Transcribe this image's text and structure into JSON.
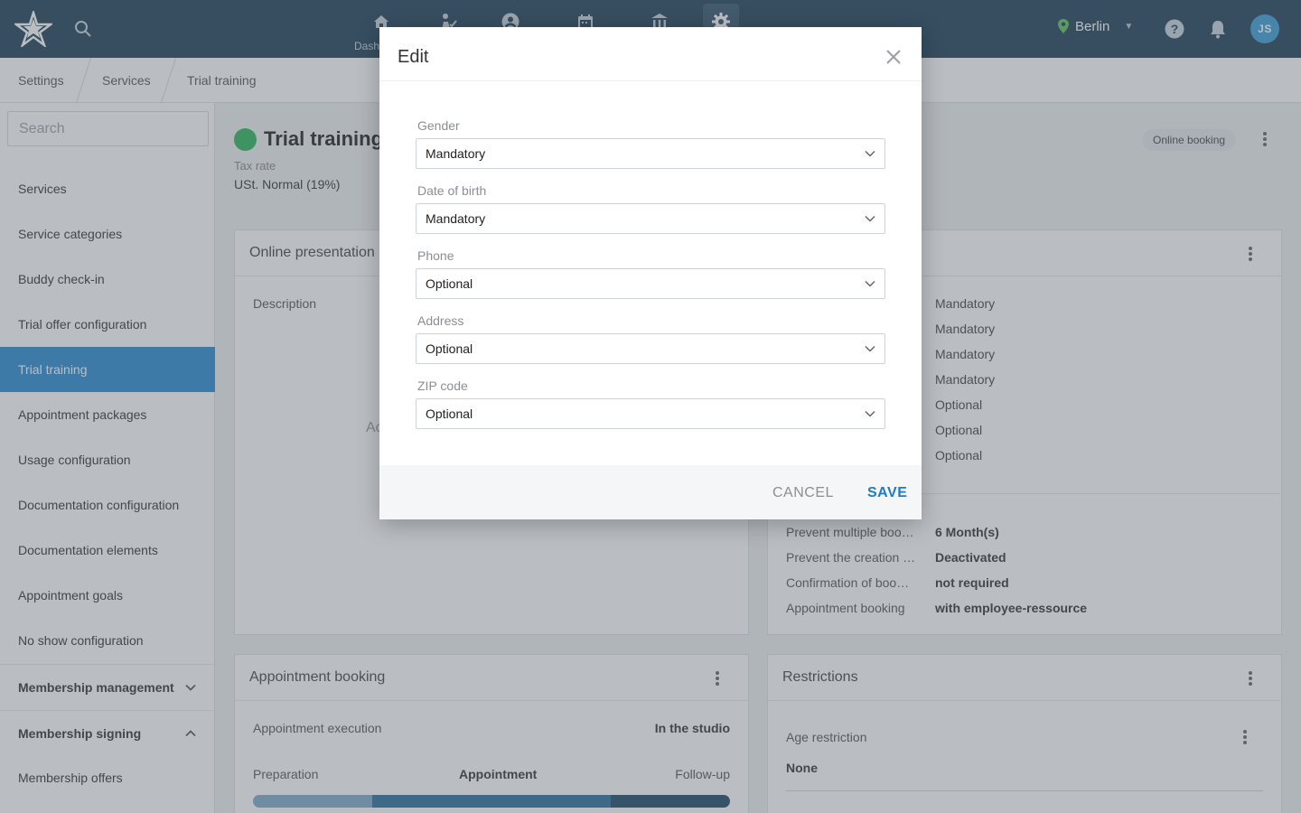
{
  "topbar": {
    "nav_partial_label": "Dash",
    "location": "Berlin",
    "user_initials": "JS"
  },
  "breadcrumb": [
    "Settings",
    "Services",
    "Trial training"
  ],
  "sidebar": {
    "search_placeholder": "Search",
    "items": [
      {
        "label": "Services"
      },
      {
        "label": "Service categories"
      },
      {
        "label": "Buddy check-in"
      },
      {
        "label": "Trial offer configuration"
      },
      {
        "label": "Trial training",
        "active": true
      },
      {
        "label": "Appointment packages"
      },
      {
        "label": "Usage configuration"
      },
      {
        "label": "Documentation configuration"
      },
      {
        "label": "Documentation elements"
      },
      {
        "label": "Appointment goals"
      },
      {
        "label": "No show configuration"
      }
    ],
    "groups": [
      {
        "label": "Membership management",
        "expanded": false
      },
      {
        "label": "Membership signing",
        "expanded": true
      }
    ],
    "sub_items": [
      {
        "label": "Membership offers"
      }
    ]
  },
  "service": {
    "title": "Trial training",
    "tax_label": "Tax rate",
    "tax_value": "USt. Normal (19%)",
    "online_badge": "Online booking",
    "status_color": "#2bb35b"
  },
  "online_presentation": {
    "title": "Online presentation",
    "description_label": "Description",
    "partial_text": "Ac"
  },
  "customer_data_values": [
    "Mandatory",
    "Mandatory",
    "Mandatory",
    "Mandatory",
    "Optional",
    "Optional",
    "Optional"
  ],
  "booking_settings": [
    {
      "label": "Prevent multiple boo…",
      "value": "6 Month(s)"
    },
    {
      "label": "Prevent the creation …",
      "value": "Deactivated"
    },
    {
      "label": "Confirmation of boo…",
      "value": "not required"
    },
    {
      "label": "Appointment booking",
      "value": "with employee-ressource"
    }
  ],
  "appointment_booking": {
    "title": "Appointment booking",
    "execution_label": "Appointment execution",
    "execution_value": "In the studio",
    "phases": [
      "Preparation",
      "Appointment",
      "Follow-up"
    ],
    "phase_fractions": [
      0.25,
      0.5,
      0.25
    ],
    "phase_colors": [
      "#7fa9c8",
      "#2a6f9e",
      "#1c4966"
    ]
  },
  "restrictions": {
    "title": "Restrictions",
    "age_label": "Age restriction",
    "age_value": "None"
  },
  "modal": {
    "title": "Edit",
    "fields": [
      {
        "label": "Gender",
        "value": "Mandatory"
      },
      {
        "label": "Date of birth",
        "value": "Mandatory"
      },
      {
        "label": "Phone",
        "value": "Optional"
      },
      {
        "label": "Address",
        "value": "Optional"
      },
      {
        "label": "ZIP code",
        "value": "Optional"
      }
    ],
    "cancel_label": "CANCEL",
    "save_label": "SAVE"
  },
  "colors": {
    "topbar": "#1d3e56",
    "accent": "#2a8ad1",
    "save": "#1e7bc4"
  }
}
